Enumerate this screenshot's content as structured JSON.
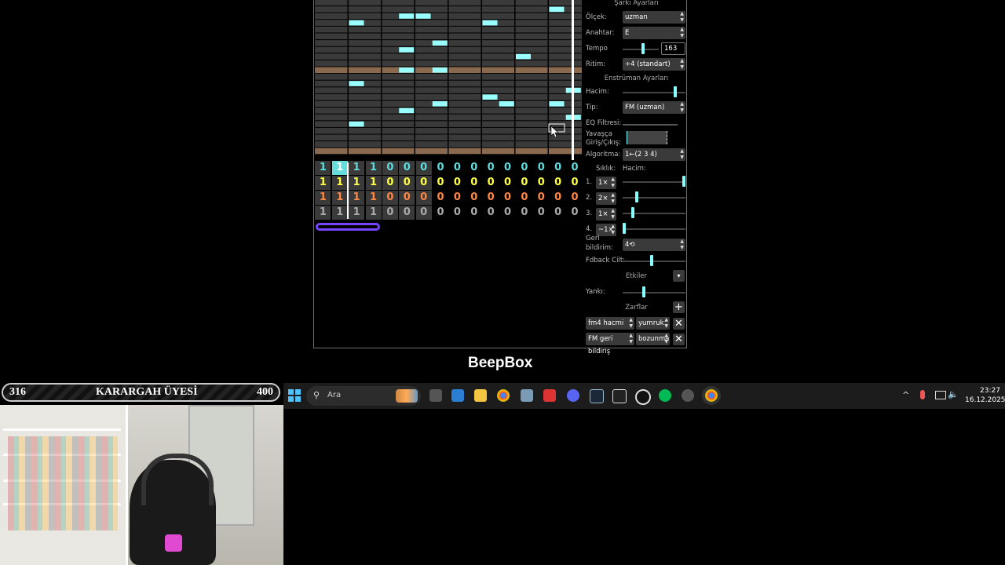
{
  "app": {
    "name": "BeepBox"
  },
  "colors": {
    "note": "#99ffff",
    "sel": "#66dddd",
    "loop": "#7744ff",
    "accent": "#8ff"
  },
  "sequencer": {
    "rows": [
      {
        "color": "#5fdcdc",
        "values": [
          "1",
          "1",
          "1",
          "1",
          "0",
          "0",
          "0",
          "0",
          "0",
          "0",
          "0",
          "0",
          "0",
          "0",
          "0",
          "0"
        ]
      },
      {
        "color": "#ffff44",
        "values": [
          "1",
          "1",
          "1",
          "1",
          "0",
          "0",
          "0",
          "0",
          "0",
          "0",
          "0",
          "0",
          "0",
          "0",
          "0",
          "0"
        ]
      },
      {
        "color": "#ff8844",
        "values": [
          "1",
          "1",
          "1",
          "1",
          "0",
          "0",
          "0",
          "0",
          "0",
          "0",
          "0",
          "0",
          "0",
          "0",
          "0",
          "0"
        ]
      },
      {
        "color": "#aaaaaa",
        "values": [
          "1",
          "1",
          "1",
          "1",
          "0",
          "0",
          "0",
          "0",
          "0",
          "0",
          "0",
          "0",
          "0",
          "0",
          "0",
          "0"
        ]
      }
    ],
    "selected_cell": 1
  },
  "settings": {
    "song_header": "Şarkı Ayarları",
    "scale_label": "Ölçek:",
    "scale_value": "uzman",
    "key_label": "Anahtar:",
    "key_value": "E",
    "tempo_label": "Tempo",
    "tempo_value": "163",
    "rhythm_label": "Ritim:",
    "rhythm_value": "÷4 (standart)",
    "instrument_header": "Enstrüman Ayarları",
    "volume_label": "Hacim:",
    "type_label": "Tip:",
    "type_value": "FM (uzman)",
    "eq_label": "EQ Filtresi:",
    "fade_label_1": "Yavaşça",
    "fade_label_2": "Giriş/Çıkış:",
    "algorithm_label": "Algoritma:",
    "algorithm_value": "1←(2 3 4)",
    "freq_header": "Sıklık:",
    "vol_header": "Hacim:",
    "operators": [
      {
        "num": "1.",
        "freq": "1×"
      },
      {
        "num": "2.",
        "freq": "2×"
      },
      {
        "num": "3.",
        "freq": "1×"
      },
      {
        "num": "4.",
        "freq": "~1×"
      }
    ],
    "feedback_label_1": "Geri",
    "feedback_label_2": "bildirim:",
    "feedback_value": "4⟲",
    "fb_volume_label": "Fdback Cilt:",
    "effects_label": "Etkiler",
    "echo_label": "Yankı:",
    "envelopes_label": "Zarflar",
    "envelopes": [
      {
        "target": "fm4 hacmi",
        "type": "yumruk"
      },
      {
        "target": "FM geri bildiriş",
        "type": "bozunma"
      }
    ]
  },
  "overlay": {
    "membership": {
      "left": "316",
      "title": "KARARGAH ÜYESİ",
      "right": "400"
    }
  },
  "taskbar": {
    "search_placeholder": "Ara",
    "time": "23:27",
    "date": "16.12.2025"
  }
}
